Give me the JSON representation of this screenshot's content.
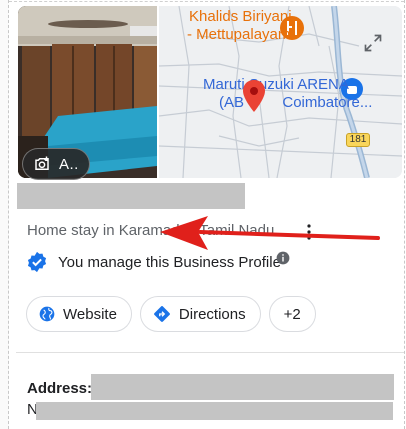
{
  "photo": {
    "add_photo_label": "A..",
    "add_photo_icon": "add-photo-icon"
  },
  "map": {
    "restaurant_name": "Khalids Biriyani",
    "restaurant_area": "- Mettupalayam",
    "dealer_name": "Maruti Suzuki ARENA",
    "dealer_name2": "(AB",
    "dealer_name3": "Coimbatore...",
    "road_number": "181",
    "expand_icon": "expand-icon",
    "colors": {
      "restaurant": "#e8710a",
      "dealer": "#3367d6",
      "pin": "#ea4335",
      "road": "#9bb7d4"
    }
  },
  "profile": {
    "category": "Home stay in Karamadai, Tamil Nadu",
    "manage_text": "You manage this Business Profile",
    "verified_icon": "verified-badge-icon",
    "info_icon": "info-icon"
  },
  "actions": {
    "website_label": "Website",
    "directions_label": "Directions",
    "more_label": "+2"
  },
  "details": {
    "address_label": "Address:",
    "address_prefix": "N"
  },
  "annotation": {
    "arrow_color": "#e0201b"
  }
}
